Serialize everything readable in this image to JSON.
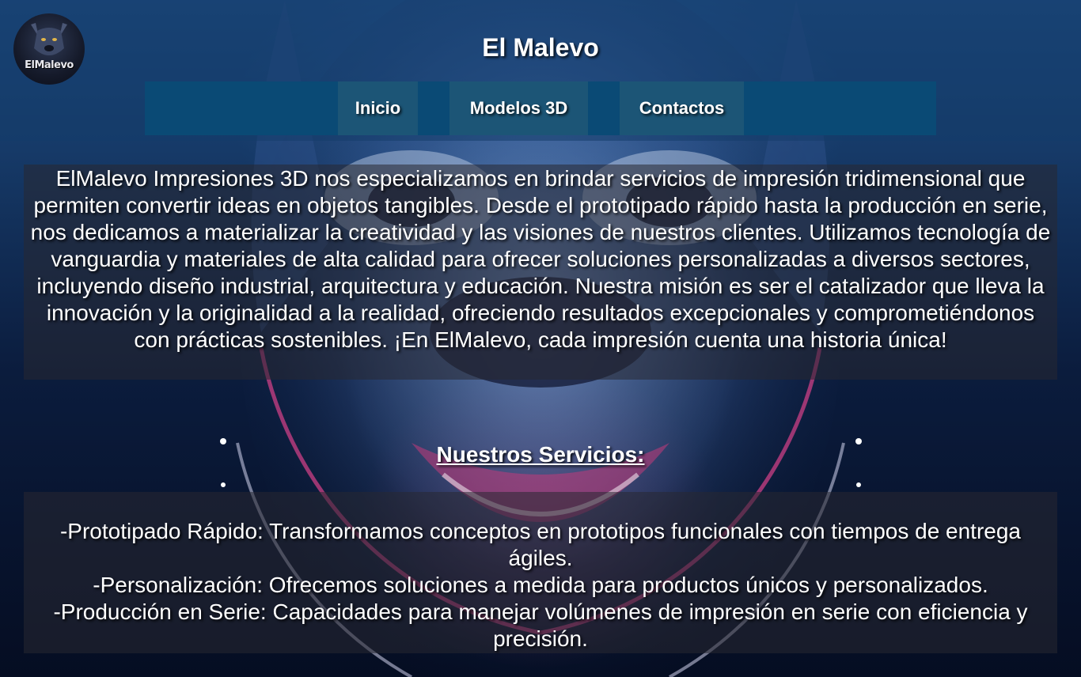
{
  "site": {
    "title": "El Malevo",
    "logo_text": "ElMalevo",
    "logo_icon": "pitbull-dog-icon"
  },
  "nav": {
    "items": [
      {
        "label": "Inicio"
      },
      {
        "label": "Modelos 3D"
      },
      {
        "label": "Contactos"
      }
    ]
  },
  "intro": {
    "text": "ElMalevo Impresiones 3D nos especializamos en brindar servicios de impresión tridimensional que permiten convertir ideas en objetos tangibles. Desde el prototipado rápido hasta la producción en serie, nos dedicamos a materializar la creatividad y las visiones de nuestros clientes. Utilizamos tecnología de vanguardia y materiales de alta calidad para ofrecer soluciones personalizadas a diversos sectores, incluyendo diseño industrial, arquitectura y educación. Nuestra misión es ser el catalizador que lleva la innovación y la originalidad a la realidad, ofreciendo resultados excepcionales y comprometiéndonos con prácticas sostenibles. ¡En ElMalevo, cada impresión cuenta una historia única!"
  },
  "services": {
    "heading": "Nuestros Servicios:",
    "items": [
      "-Prototipado Rápido: Transformamos conceptos en prototipos funcionales con tiempos de entrega ágiles.",
      "-Personalización: Ofrecemos soluciones a medida para productos únicos y personalizados.",
      "-Producción en Serie: Capacidades para manejar volúmenes de impresión en serie con eficiencia y precisión."
    ]
  },
  "colors": {
    "nav_bar": "#0a4a75",
    "nav_item": "#1c5576",
    "text": "#ffffff"
  }
}
